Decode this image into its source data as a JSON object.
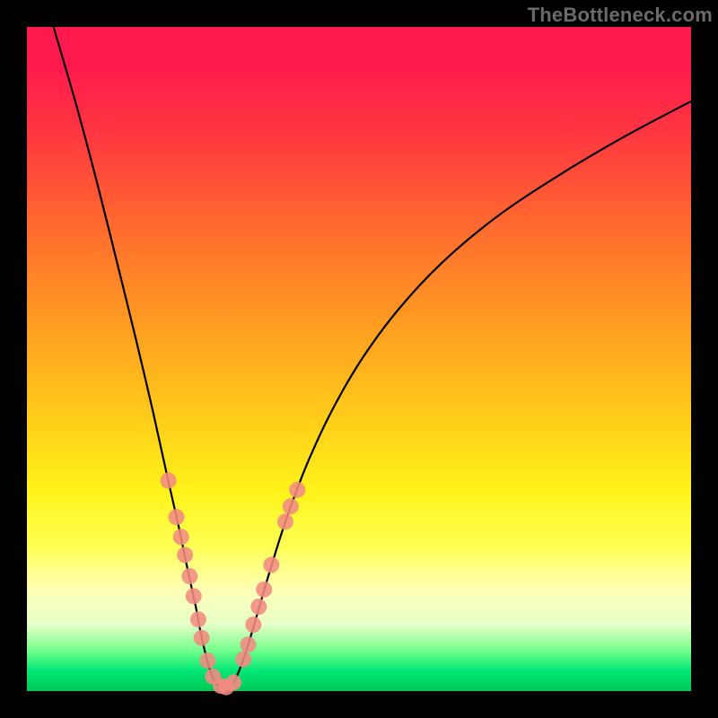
{
  "watermark": "TheBottleneck.com",
  "background": {
    "frame_color": "#000000",
    "gradient_stops": [
      {
        "pos": 0.0,
        "color": "#ff1a4d"
      },
      {
        "pos": 0.06,
        "color": "#ff1a4d"
      },
      {
        "pos": 0.17,
        "color": "#ff3a3f"
      },
      {
        "pos": 0.3,
        "color": "#ff6a2f"
      },
      {
        "pos": 0.44,
        "color": "#ff9a22"
      },
      {
        "pos": 0.58,
        "color": "#ffc91a"
      },
      {
        "pos": 0.7,
        "color": "#fff31a"
      },
      {
        "pos": 0.78,
        "color": "#ffff52"
      },
      {
        "pos": 0.85,
        "color": "#fdffb8"
      },
      {
        "pos": 0.9,
        "color": "#e6ffc7"
      },
      {
        "pos": 0.94,
        "color": "#6fff8a"
      },
      {
        "pos": 0.97,
        "color": "#00e676"
      },
      {
        "pos": 1.0,
        "color": "#00c853"
      }
    ]
  },
  "chart_data": {
    "type": "line",
    "title": "",
    "xlabel": "",
    "ylabel": "",
    "xlim": [
      0,
      1
    ],
    "ylim": [
      0,
      1
    ],
    "series": [
      {
        "name": "bottleneck-curve",
        "points": [
          {
            "x": 0.04,
            "y": 1.0
          },
          {
            "x": 0.075,
            "y": 0.88
          },
          {
            "x": 0.107,
            "y": 0.76
          },
          {
            "x": 0.137,
            "y": 0.64
          },
          {
            "x": 0.164,
            "y": 0.53
          },
          {
            "x": 0.19,
            "y": 0.42
          },
          {
            "x": 0.212,
            "y": 0.32
          },
          {
            "x": 0.228,
            "y": 0.25
          },
          {
            "x": 0.242,
            "y": 0.183
          },
          {
            "x": 0.254,
            "y": 0.128
          },
          {
            "x": 0.262,
            "y": 0.086
          },
          {
            "x": 0.271,
            "y": 0.048
          },
          {
            "x": 0.279,
            "y": 0.022
          },
          {
            "x": 0.288,
            "y": 0.008
          },
          {
            "x": 0.297,
            "y": 0.005
          },
          {
            "x": 0.306,
            "y": 0.008
          },
          {
            "x": 0.315,
            "y": 0.02
          },
          {
            "x": 0.33,
            "y": 0.06
          },
          {
            "x": 0.348,
            "y": 0.12
          },
          {
            "x": 0.367,
            "y": 0.185
          },
          {
            "x": 0.391,
            "y": 0.26
          },
          {
            "x": 0.421,
            "y": 0.34
          },
          {
            "x": 0.458,
            "y": 0.42
          },
          {
            "x": 0.503,
            "y": 0.498
          },
          {
            "x": 0.558,
            "y": 0.573
          },
          {
            "x": 0.625,
            "y": 0.645
          },
          {
            "x": 0.706,
            "y": 0.713
          },
          {
            "x": 0.8,
            "y": 0.776
          },
          {
            "x": 0.9,
            "y": 0.835
          },
          {
            "x": 1.0,
            "y": 0.888
          }
        ]
      }
    ],
    "markers": {
      "color": "#f28b82",
      "points": [
        {
          "x": 0.213,
          "y": 0.317
        },
        {
          "x": 0.225,
          "y": 0.262
        },
        {
          "x": 0.232,
          "y": 0.232
        },
        {
          "x": 0.238,
          "y": 0.205
        },
        {
          "x": 0.245,
          "y": 0.173
        },
        {
          "x": 0.251,
          "y": 0.143
        },
        {
          "x": 0.258,
          "y": 0.108
        },
        {
          "x": 0.263,
          "y": 0.08
        },
        {
          "x": 0.272,
          "y": 0.046
        },
        {
          "x": 0.28,
          "y": 0.022
        },
        {
          "x": 0.292,
          "y": 0.008
        },
        {
          "x": 0.3,
          "y": 0.006
        },
        {
          "x": 0.311,
          "y": 0.013
        },
        {
          "x": 0.326,
          "y": 0.048
        },
        {
          "x": 0.333,
          "y": 0.07
        },
        {
          "x": 0.341,
          "y": 0.1
        },
        {
          "x": 0.349,
          "y": 0.127
        },
        {
          "x": 0.357,
          "y": 0.153
        },
        {
          "x": 0.368,
          "y": 0.19
        },
        {
          "x": 0.389,
          "y": 0.255
        },
        {
          "x": 0.397,
          "y": 0.278
        },
        {
          "x": 0.407,
          "y": 0.303
        }
      ]
    }
  }
}
